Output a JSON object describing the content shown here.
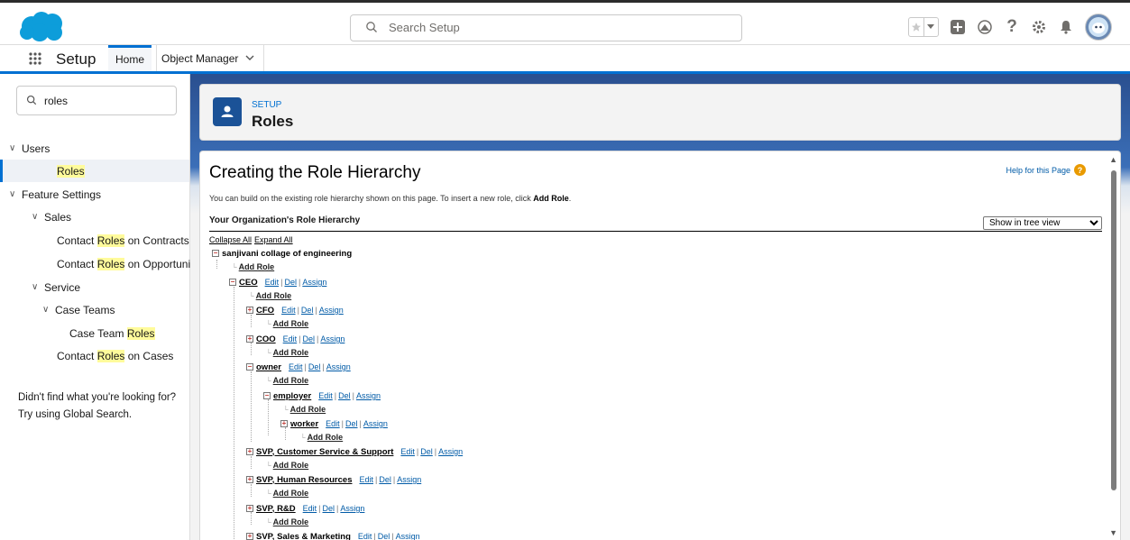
{
  "header": {
    "search_placeholder": "Search Setup",
    "icons": [
      "star-icon",
      "chevron-down-icon",
      "add-icon",
      "trailhead-icon",
      "help-icon",
      "gear-icon",
      "bell-icon",
      "avatar-icon"
    ]
  },
  "nav": {
    "app_name": "Setup",
    "tabs": [
      "Home",
      "Object Manager"
    ]
  },
  "sidebar": {
    "search_value": "roles",
    "items": [
      {
        "label": "Users",
        "level": 0
      },
      {
        "label": "Roles",
        "level": 1,
        "selected": true
      },
      {
        "label": "Feature Settings",
        "level": 0
      },
      {
        "label": "Sales",
        "level": 1
      },
      {
        "pre": "Contact ",
        "hl": "Roles",
        "post": " on Contracts"
      },
      {
        "pre": "Contact ",
        "hl": "Roles",
        "post": " on Opportunities"
      },
      {
        "label": "Service",
        "level": 1
      },
      {
        "label": "Case Teams",
        "level": 2
      },
      {
        "pre": "Case Team ",
        "hl": "Roles",
        "post": ""
      },
      {
        "pre": "Contact ",
        "hl": "Roles",
        "post": " on Cases"
      }
    ],
    "note_line1": "Didn't find what you're looking for?",
    "note_line2": "Try using Global Search."
  },
  "page_header": {
    "eyebrow": "SETUP",
    "title": "Roles"
  },
  "content": {
    "title": "Creating the Role Hierarchy",
    "help_link": "Help for this Page",
    "desc_prefix": "You can build on the existing role hierarchy shown on this page. To insert a new role, click ",
    "desc_bold": "Add Role",
    "desc_suffix": ".",
    "hierarchy_heading": "Your Organization's Role Hierarchy",
    "view_select": "Show in tree view",
    "collapse_all": "Collapse All",
    "expand_all": "Expand All",
    "root": "sanjivani collage of engineering",
    "add_role": "Add Role",
    "actions": {
      "edit": "Edit",
      "del": "Del",
      "assign": "Assign"
    },
    "roles": {
      "ceo": "CEO",
      "cfo": "CFO",
      "coo": "COO",
      "owner": "owner",
      "employer": "employer",
      "worker": "worker",
      "svp_css": "SVP, Customer Service & Support",
      "svp_hr": "SVP, Human Resources",
      "svp_rd": "SVP, R&D",
      "svp_sm": "SVP, Sales & Marketing"
    }
  }
}
